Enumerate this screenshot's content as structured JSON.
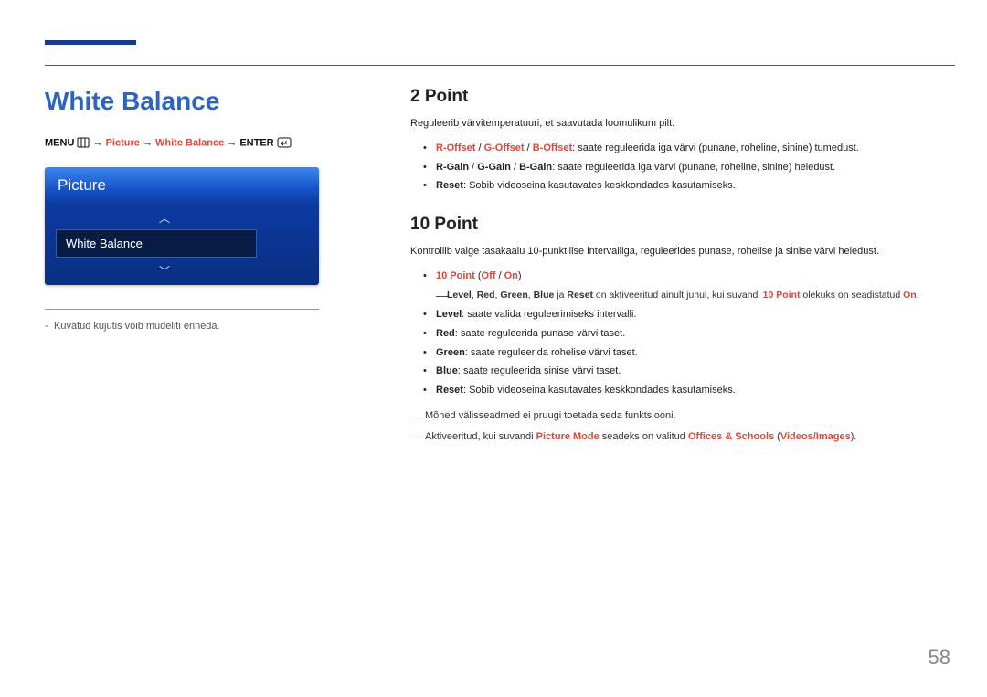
{
  "page_number": "58",
  "left": {
    "title": "White Balance",
    "breadcrumb": {
      "p1": "MENU",
      "p2": "Picture",
      "p3": "White Balance",
      "p4": "ENTER",
      "arrow": "→"
    },
    "osd": {
      "header": "Picture",
      "selected": "White Balance"
    },
    "footnote": "Kuvatud kujutis võib mudeliti erineda."
  },
  "right": {
    "section1": {
      "title": "2 Point",
      "intro": "Reguleerib värvitemperatuuri, et saavutada loomulikum pilt.",
      "items": [
        {
          "lead_hl": "R-Offset",
          "sep1": " / ",
          "mid_hl": "G-Offset",
          "sep2": " / ",
          "end_hl": "B-Offset",
          "rest": ": saate reguleerida iga värvi (punane, roheline, sinine) tumedust."
        },
        {
          "lead_hl": "R-Gain",
          "sep1": " / ",
          "mid_hl": "G-Gain",
          "sep2": " / ",
          "end_hl": "B-Gain",
          "rest": ": saate reguleerida iga värvi (punane, roheline, sinine) heledust."
        },
        {
          "lead_hl": "Reset",
          "rest": ": Sobib videoseina kasutavates keskkondades kasutamiseks."
        }
      ]
    },
    "section2": {
      "title": "10 Point",
      "intro": "Kontrollib valge tasakaalu 10-punktilise intervalliga, reguleerides punase, rohelise ja sinise värvi heledust.",
      "items": [
        {
          "content_hl": "10 Point",
          "paren_pre": " (",
          "opt1": "Off",
          "optsep": " / ",
          "opt2": "On",
          "paren_post": ")"
        }
      ],
      "note_after_first": {
        "l": "Level",
        "r": "Red",
        "g": "Green",
        "b": "Blue",
        "reset": "Reset",
        "mid1": " ja ",
        "mid2": " on aktiveeritud ainult juhul, kui suvandi ",
        "tenpoint": "10 Point",
        "mid3": " olekuks on seadistatud ",
        "on": "On",
        "dot": "."
      },
      "rest_items": [
        {
          "lead_hl": "Level",
          "rest": ": saate valida reguleerimiseks intervalli."
        },
        {
          "lead_hl": "Red",
          "rest": ": saate reguleerida punase värvi taset."
        },
        {
          "lead_hl": "Green",
          "rest": ": saate reguleerida rohelise värvi taset."
        },
        {
          "lead_hl": "Blue",
          "rest": ": saate reguleerida sinise värvi taset."
        },
        {
          "lead_hl": "Reset",
          "rest": ": Sobib videoseina kasutavates keskkondades kasutamiseks."
        }
      ],
      "trailing_notes": [
        {
          "text": "Mõned välisseadmed ei pruugi toetada seda funktsiooni."
        },
        {
          "pre": "Aktiveeritud, kui suvandi ",
          "pm": "Picture Mode",
          "mid": " seadeks on valitud ",
          "os": "Offices & Schools",
          "paren_pre": " (",
          "vi": "Videos/Images",
          "paren_post": ")."
        }
      ]
    }
  }
}
